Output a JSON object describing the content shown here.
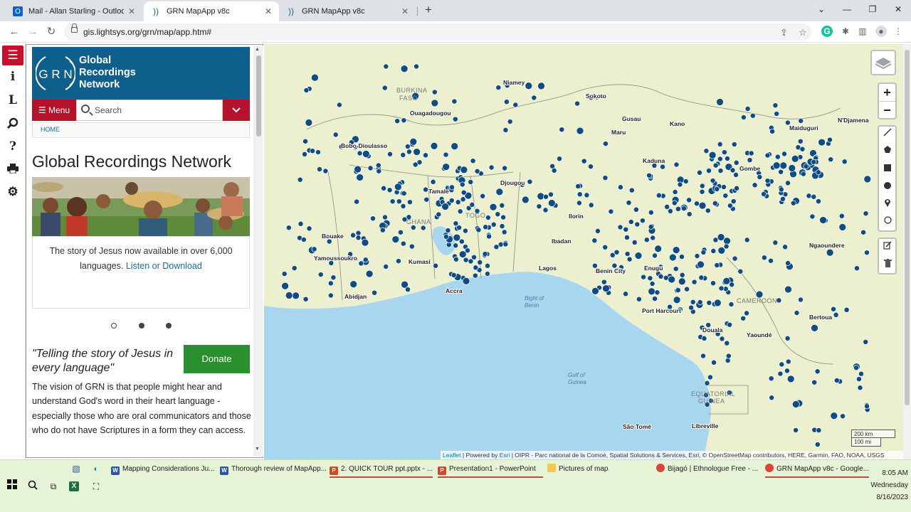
{
  "browser": {
    "tabs": [
      {
        "label": "Mail - Allan Starling - Outlook",
        "icon": "outlook-icon"
      },
      {
        "label": "GRN MapApp v8c",
        "icon": "grn-icon"
      },
      {
        "label": "GRN MapApp v8c",
        "icon": "grn-icon"
      }
    ],
    "url": "gis.lightsys.org/grn/map/app.htm#"
  },
  "rail": {
    "items": [
      "menu-icon",
      "info-icon",
      "legend-icon",
      "search-icon",
      "help-icon",
      "print-icon",
      "gear-icon"
    ],
    "info_glyph": "i",
    "legend_glyph": "L",
    "help_glyph": "?"
  },
  "panel": {
    "logo_text": "G R N",
    "brand_line1": "Global",
    "brand_line2": "Recordings",
    "brand_line3": "Network",
    "menu_label": "Menu",
    "search_placeholder": "Search",
    "breadcrumb": "HOME",
    "page_title": "Global Recordings Network",
    "slide_text": "The story of Jesus now available in over 6,000 languages.",
    "slide_link": "Listen or Download",
    "tagline": "\"Telling the story of Jesus in every language\"",
    "donate_label": "Donate",
    "vision_text": "The vision of GRN is that people might hear and understand God's word in their heart language - especially those who are oral communicators and those who do not have Scriptures in a form they can access."
  },
  "map": {
    "labels": [
      {
        "text": "BURKINA",
        "kind": "country"
      },
      {
        "text": "FASO",
        "kind": "country"
      },
      {
        "text": "Ouagadougou",
        "kind": "city"
      },
      {
        "text": "Niamey",
        "kind": "city"
      },
      {
        "text": "Sokoto",
        "kind": "city"
      },
      {
        "text": "Gusau",
        "kind": "city"
      },
      {
        "text": "Maru",
        "kind": "city"
      },
      {
        "text": "Kano",
        "kind": "city"
      },
      {
        "text": "Maiduguri",
        "kind": "city"
      },
      {
        "text": "N'Djamena",
        "kind": "city"
      },
      {
        "text": "Bobo-Dioulasso",
        "kind": "city"
      },
      {
        "text": "Kaduna",
        "kind": "city"
      },
      {
        "text": "Gombe",
        "kind": "city"
      },
      {
        "text": "Tamale",
        "kind": "city"
      },
      {
        "text": "Djougou",
        "kind": "city"
      },
      {
        "text": "TOGO",
        "kind": "country"
      },
      {
        "text": "GHANA",
        "kind": "country"
      },
      {
        "text": "Ilorin",
        "kind": "city"
      },
      {
        "text": "Bouake",
        "kind": "city"
      },
      {
        "text": "Ibadan",
        "kind": "city"
      },
      {
        "text": "Ngaoundere",
        "kind": "city"
      },
      {
        "text": "Yamoussoukro",
        "kind": "city"
      },
      {
        "text": "Kumasi",
        "kind": "city"
      },
      {
        "text": "Lagos",
        "kind": "city"
      },
      {
        "text": "Benin City",
        "kind": "city"
      },
      {
        "text": "Enugu",
        "kind": "city"
      },
      {
        "text": "Abidjan",
        "kind": "city"
      },
      {
        "text": "Accra",
        "kind": "city"
      },
      {
        "text": "Bight of",
        "kind": "water"
      },
      {
        "text": "Benin",
        "kind": "water"
      },
      {
        "text": "Port Harcourt",
        "kind": "city"
      },
      {
        "text": "CAMEROON",
        "kind": "country"
      },
      {
        "text": "Bertoua",
        "kind": "city"
      },
      {
        "text": "Douala",
        "kind": "city"
      },
      {
        "text": "Yaoundé",
        "kind": "city"
      },
      {
        "text": "Gulf of",
        "kind": "water"
      },
      {
        "text": "Guinea",
        "kind": "water"
      },
      {
        "text": "EQUATORIAL",
        "kind": "country"
      },
      {
        "text": "GUINEA",
        "kind": "country"
      },
      {
        "text": "Libreville",
        "kind": "city"
      },
      {
        "text": "São Tomé",
        "kind": "city"
      }
    ],
    "attribution_leaflet": "Leaflet",
    "attribution_powered": " | Powered by ",
    "attribution_esri": "Esri",
    "attribution_rest": " | OIPR - Parc national de la Comoé, Spatial Solutions & Services, Esri, © OpenStreetMap contributors, HERE, Garmin, FAO, NOAA, USGS",
    "scale_km": "200 km",
    "scale_mi": "100 mi",
    "zoom_in": "+",
    "zoom_out": "−",
    "marker_color": "#0f4c81",
    "water_color": "#a9d6ef",
    "land_color": "#ecf0cf"
  },
  "taskbar": {
    "apps": [
      {
        "label": "Mapping Considerations Ju...",
        "icon": "word-icon",
        "glyph": "W"
      },
      {
        "label": "Thorough review of MapApp...",
        "icon": "word-icon",
        "glyph": "W"
      },
      {
        "label": "2. QUICK TOUR ppt.pptx - ...",
        "icon": "powerpoint-icon",
        "glyph": "P"
      },
      {
        "label": "Presentation1 - PowerPoint",
        "icon": "powerpoint-icon",
        "glyph": "P"
      },
      {
        "label": "Pictures of map",
        "icon": "folder-icon",
        "glyph": ""
      },
      {
        "label": "Bijagó | Ethnologue Free - ...",
        "icon": "chrome-icon",
        "glyph": ""
      },
      {
        "label": "GRN MapApp v8c - Google...",
        "icon": "chrome-icon",
        "glyph": ""
      }
    ],
    "time": "8:05 AM",
    "day": "Wednesday",
    "date": "8/16/2023"
  }
}
